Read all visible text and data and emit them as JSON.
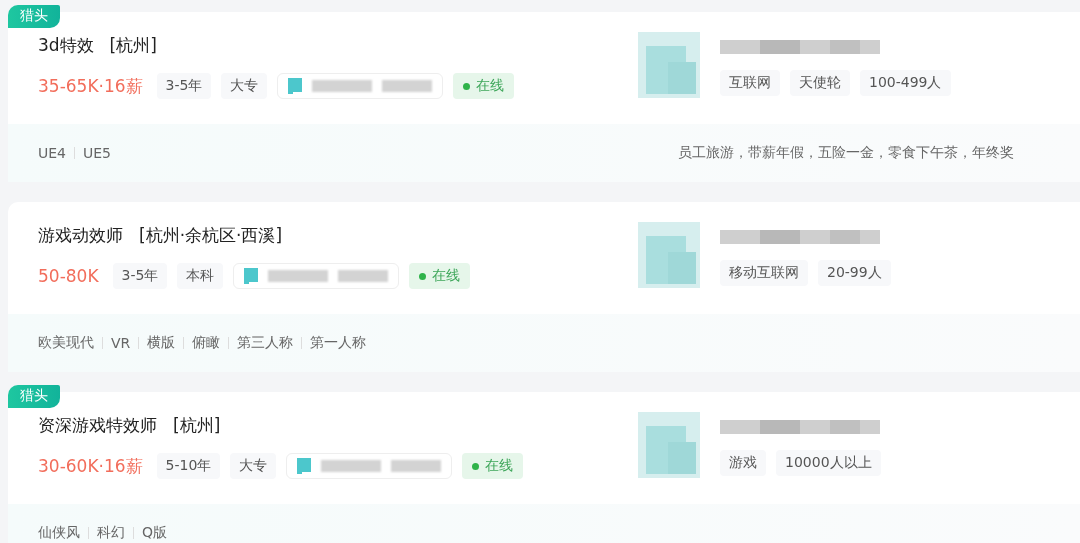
{
  "jobs": [
    {
      "badge": "猎头",
      "title": "3d特效",
      "location": "[杭州]",
      "salary": "35-65K·16薪",
      "requirements": [
        "3-5年",
        "大专"
      ],
      "status": {
        "label": "在线",
        "online": true
      },
      "company_tags": [
        "互联网",
        "天使轮",
        "100-499人"
      ],
      "skills": [
        "UE4",
        "UE5"
      ],
      "benefits": "员工旅游，带薪年假，五险一金，零食下午茶，年终奖"
    },
    {
      "title": "游戏动效师",
      "location": "[杭州·余杭区·西溪]",
      "salary": "50-80K",
      "requirements": [
        "3-5年",
        "本科"
      ],
      "status": {
        "label": "在线",
        "online": true
      },
      "company_tags": [
        "移动互联网",
        "20-99人"
      ],
      "skills": [
        "欧美现代",
        "VR",
        "横版",
        "俯瞰",
        "第三人称",
        "第一人称"
      ]
    },
    {
      "badge": "猎头",
      "title": "资深游戏特效师",
      "location": "[杭州]",
      "salary": "30-60K·16薪",
      "requirements": [
        "5-10年",
        "大专"
      ],
      "status": {
        "label": "在线",
        "online": true
      },
      "company_tags": [
        "游戏",
        "10000人以上"
      ],
      "skills": [
        "仙侠风",
        "科幻",
        "Q版"
      ]
    }
  ]
}
